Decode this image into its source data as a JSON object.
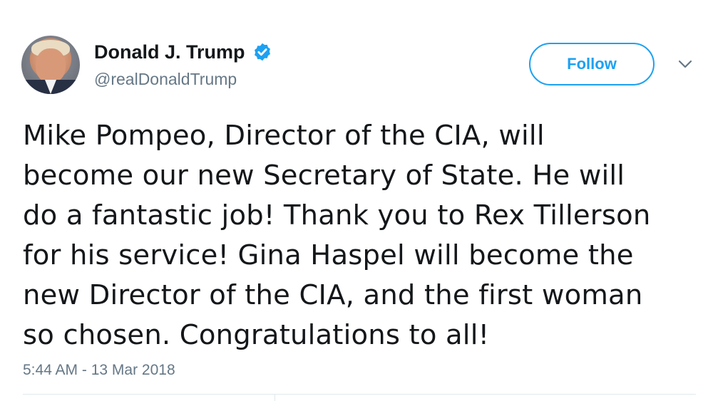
{
  "user": {
    "display_name": "Donald J. Trump",
    "handle": "@realDonaldTrump",
    "verified_icon": "verified-badge-icon",
    "avatar_icon": "profile-photo"
  },
  "actions": {
    "follow_label": "Follow",
    "menu_icon": "chevron-down-icon"
  },
  "tweet": {
    "lines": [
      "Mike Pompeo, Director of the CIA, will",
      "become our new Secretary of State. He will",
      "do a fantastic job! Thank you to Rex Tillerson",
      "for his service! Gina Haspel will become the",
      "new Director of the CIA, and the first woman",
      "so chosen. Congratulations to all!"
    ],
    "timestamp": "5:44 AM - 13 Mar 2018"
  },
  "colors": {
    "accent": "#1da1f2",
    "text": "#14171a",
    "secondary_text": "#657786",
    "divider": "#e1e8ed"
  }
}
